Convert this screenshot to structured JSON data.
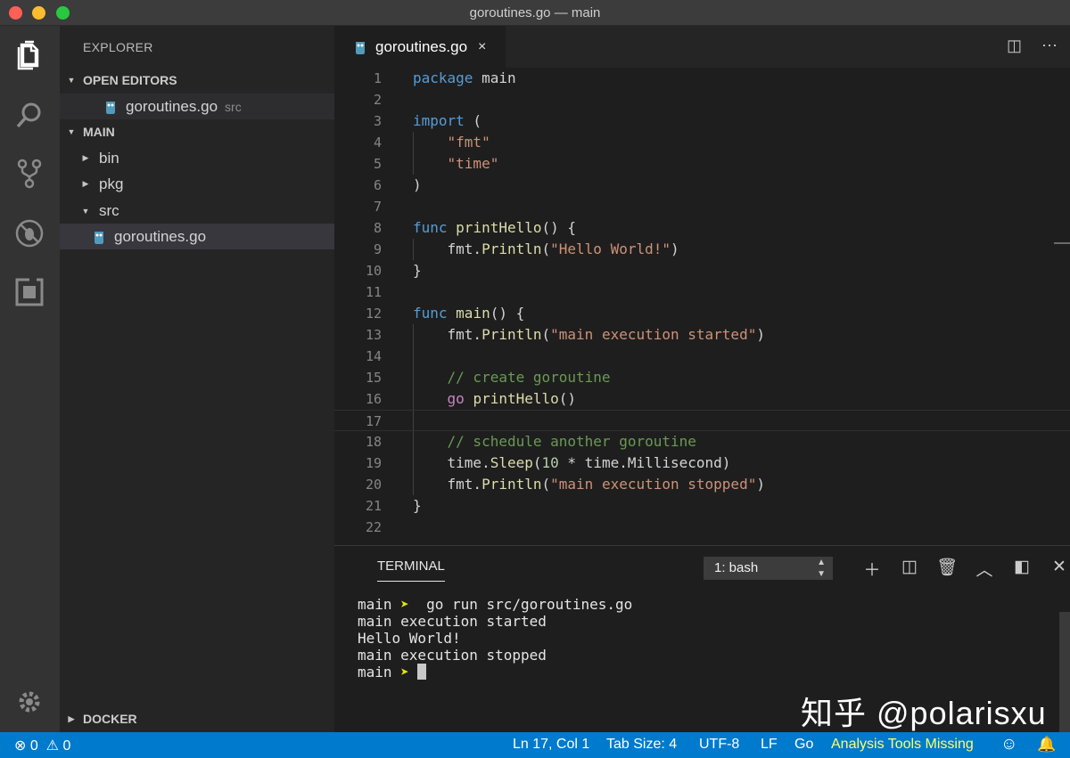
{
  "window": {
    "title": "goroutines.go — main"
  },
  "activity_bar": {
    "icons": [
      "files-icon",
      "search-icon",
      "source-control-icon",
      "debug-icon",
      "extensions-icon",
      "gear-icon"
    ]
  },
  "sidebar": {
    "title": "EXPLORER",
    "open_editors_label": "OPEN EDITORS",
    "open_editor": {
      "name": "goroutines.go",
      "hint": "src"
    },
    "main_label": "MAIN",
    "tree": [
      {
        "name": "bin",
        "expanded": false
      },
      {
        "name": "pkg",
        "expanded": false
      },
      {
        "name": "src",
        "expanded": true
      },
      {
        "name": "goroutines.go",
        "selected": true
      }
    ],
    "docker_label": "DOCKER"
  },
  "editor": {
    "tab": {
      "label": "goroutines.go",
      "close": "×"
    },
    "lines": [
      "package main",
      "",
      "import (",
      "\"fmt\"",
      "\"time\"",
      ")",
      "",
      "func printHello() {",
      "fmt.Println(\"Hello World!\")",
      "}",
      "",
      "func main() {",
      "fmt.Println(\"main execution started\")",
      "",
      "// create goroutine",
      "go printHello()",
      "",
      "// schedule another goroutine",
      "time.Sleep(10 * time.Millisecond)",
      "fmt.Println(\"main execution stopped\")",
      "}",
      ""
    ],
    "line_numbers": [
      "1",
      "2",
      "3",
      "4",
      "5",
      "6",
      "7",
      "8",
      "9",
      "10",
      "11",
      "12",
      "13",
      "14",
      "15",
      "16",
      "17",
      "18",
      "19",
      "20",
      "21",
      "22"
    ]
  },
  "panel": {
    "tab": "TERMINAL",
    "shell_select": "1: bash",
    "terminal": {
      "prompt": "main",
      "arrow": "➤",
      "command": "go run src/goroutines.go",
      "output": [
        "main execution started",
        "Hello World!",
        "main execution stopped"
      ]
    }
  },
  "watermark": "知乎 @polarisxu",
  "statusbar": {
    "errors": "0",
    "warnings": "0",
    "position": "Ln 17, Col 1",
    "tab_size": "Tab Size: 4",
    "encoding": "UTF-8",
    "eol": "LF",
    "language": "Go",
    "analysis": "Analysis Tools Missing"
  },
  "colors": {
    "statusbar": "#007acc",
    "keyword": "#569cd6",
    "string": "#ce9178",
    "function": "#dcdcaa",
    "comment": "#6a9955",
    "go_keyword": "#c586c0",
    "warning_text": "#ffff6b"
  }
}
